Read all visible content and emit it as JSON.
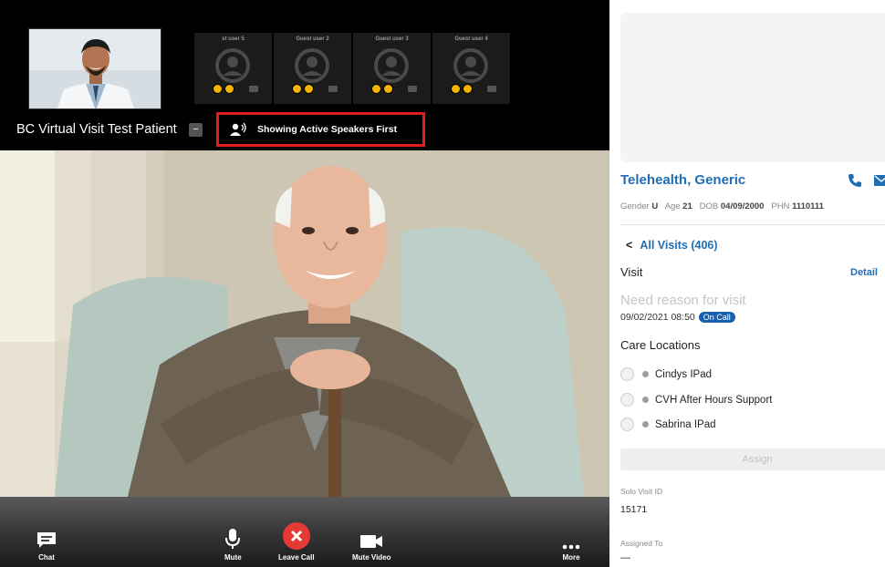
{
  "top_strip": {
    "guests": [
      {
        "name": "st user 5"
      },
      {
        "name": "Guest user 2"
      },
      {
        "name": "Guest user 3"
      },
      {
        "name": "Guest user 4"
      }
    ],
    "patient_name": "BC Virtual Visit Test Patient",
    "patient_menu": "−",
    "speakers_label": "Showing Active Speakers First"
  },
  "controls": {
    "chat": "Chat",
    "mute": "Mute",
    "leave": "Leave Call",
    "mute_video": "Mute Video",
    "more": "More"
  },
  "side": {
    "patient_name": "Telehealth, Generic",
    "demographics": {
      "gender_label": "Gender",
      "gender": "U",
      "age_label": "Age",
      "age": "21",
      "dob_label": "DOB",
      "dob": "04/09/2000",
      "phn_label": "PHN",
      "phn": "1110111"
    },
    "all_visits": "All Visits (406)",
    "visit_label": "Visit",
    "detail_link": "Detail",
    "visit_reason": "Need reason for visit",
    "visit_time": "09/02/2021 08:50",
    "status_badge": "On Call",
    "care_title": "Care Locations",
    "care_locations": [
      "Cindys IPad",
      "CVH After Hours Support",
      "Sabrina IPad"
    ],
    "assign": "Assign",
    "solo_visit_label": "Solo Visit ID",
    "solo_visit_id": "15171",
    "assigned_label": "Assigned To",
    "assigned_value": "—"
  },
  "colors": {
    "accent_blue": "#1f6db5",
    "highlight_red": "#e11d1d",
    "leave_red": "#e53935",
    "badge_yellow": "#f4b400"
  },
  "icons": [
    "chat-icon",
    "mic-icon",
    "close-icon",
    "video-camera-icon",
    "more-dots-icon",
    "phone-icon",
    "mail-icon",
    "chevron-left-icon",
    "person-avatar-icon",
    "active-speaker-icon"
  ]
}
